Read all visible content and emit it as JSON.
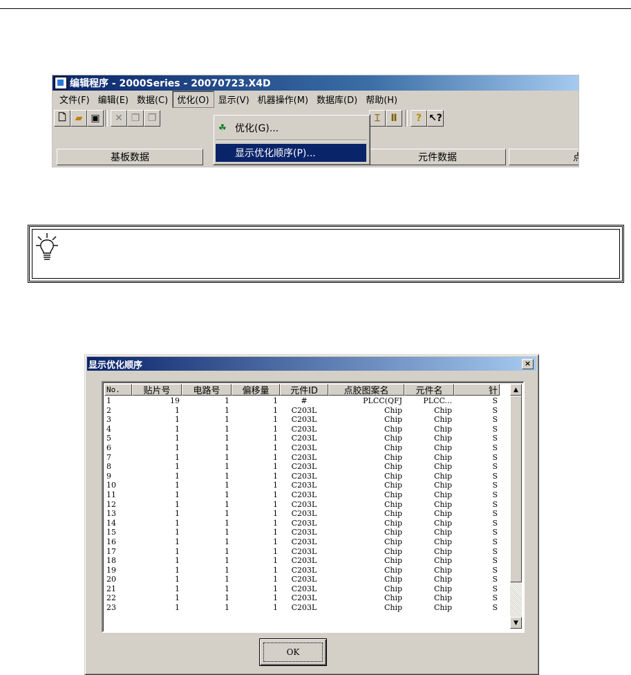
{
  "editor": {
    "title": "编辑程序 - 2000Series - 20070723.X4D",
    "menus": [
      "文件(F)",
      "编辑(E)",
      "数据(C)",
      "优化(O)",
      "显示(V)",
      "机器操作(M)",
      "数据库(D)",
      "帮助(H)"
    ],
    "open_menu": "优化(O)",
    "dropdown": [
      {
        "label": "优化(G)...",
        "icon": "optimize-icon"
      },
      {
        "label": "显示优化顺序(P)...",
        "selected": true
      }
    ],
    "tabs": [
      "基板数据",
      "元件数据",
      "点胶"
    ],
    "toolbar_icons": [
      "new-file-icon",
      "open-folder-icon",
      "save-icon",
      "delete-icon",
      "copy-icon",
      "paste-icon",
      "align-icon",
      "interval-icon",
      "help-icon",
      "context-help-icon"
    ]
  },
  "tip": {
    "icon": "lightbulb-icon"
  },
  "dialog": {
    "title": "显示优化顺序",
    "close_label": "×",
    "columns": [
      "No.",
      "贴片号",
      "电路号",
      "偏移量",
      "元件ID",
      "点胶图案名",
      "元件名",
      "针"
    ],
    "rows": [
      [
        "1",
        "19",
        "1",
        "1",
        "#",
        "PLCC(QFJ",
        "PLCC...",
        "S"
      ],
      [
        "2",
        "1",
        "1",
        "1",
        "C203L",
        "Chip",
        "Chip",
        "S"
      ],
      [
        "3",
        "1",
        "1",
        "1",
        "C203L",
        "Chip",
        "Chip",
        "S"
      ],
      [
        "4",
        "1",
        "1",
        "1",
        "C203L",
        "Chip",
        "Chip",
        "S"
      ],
      [
        "5",
        "1",
        "1",
        "1",
        "C203L",
        "Chip",
        "Chip",
        "S"
      ],
      [
        "6",
        "1",
        "1",
        "1",
        "C203L",
        "Chip",
        "Chip",
        "S"
      ],
      [
        "7",
        "1",
        "1",
        "1",
        "C203L",
        "Chip",
        "Chip",
        "S"
      ],
      [
        "8",
        "1",
        "1",
        "1",
        "C203L",
        "Chip",
        "Chip",
        "S"
      ],
      [
        "9",
        "1",
        "1",
        "1",
        "C203L",
        "Chip",
        "Chip",
        "S"
      ],
      [
        "10",
        "1",
        "1",
        "1",
        "C203L",
        "Chip",
        "Chip",
        "S"
      ],
      [
        "11",
        "1",
        "1",
        "1",
        "C203L",
        "Chip",
        "Chip",
        "S"
      ],
      [
        "12",
        "1",
        "1",
        "1",
        "C203L",
        "Chip",
        "Chip",
        "S"
      ],
      [
        "13",
        "1",
        "1",
        "1",
        "C203L",
        "Chip",
        "Chip",
        "S"
      ],
      [
        "14",
        "1",
        "1",
        "1",
        "C203L",
        "Chip",
        "Chip",
        "S"
      ],
      [
        "15",
        "1",
        "1",
        "1",
        "C203L",
        "Chip",
        "Chip",
        "S"
      ],
      [
        "16",
        "1",
        "1",
        "1",
        "C203L",
        "Chip",
        "Chip",
        "S"
      ],
      [
        "17",
        "1",
        "1",
        "1",
        "C203L",
        "Chip",
        "Chip",
        "S"
      ],
      [
        "18",
        "1",
        "1",
        "1",
        "C203L",
        "Chip",
        "Chip",
        "S"
      ],
      [
        "19",
        "1",
        "1",
        "1",
        "C203L",
        "Chip",
        "Chip",
        "S"
      ],
      [
        "20",
        "1",
        "1",
        "1",
        "C203L",
        "Chip",
        "Chip",
        "S"
      ],
      [
        "21",
        "1",
        "1",
        "1",
        "C203L",
        "Chip",
        "Chip",
        "S"
      ],
      [
        "22",
        "1",
        "1",
        "1",
        "C203L",
        "Chip",
        "Chip",
        "S"
      ],
      [
        "23",
        "1",
        "1",
        "1",
        "C203L",
        "Chip",
        "Chip",
        "S"
      ]
    ],
    "ok_label": "OK"
  },
  "colors": {
    "title_active": "#0a246a",
    "title_fade": "#a6caf0",
    "face": "#d4d0c8"
  }
}
